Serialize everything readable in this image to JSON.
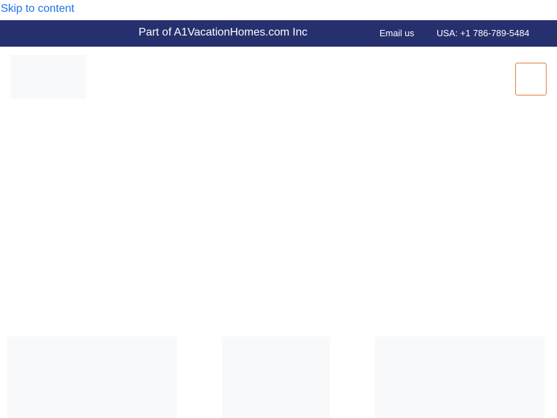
{
  "skip_link": {
    "label": "Skip to content"
  },
  "topbar": {
    "title": "Part of A1VacationHomes.com Inc",
    "email_label": "Email us",
    "phone_label": "USA: +1 786-789-5484",
    "background": "#26306e"
  },
  "header": {
    "menu_toggle_border": "#e07b39"
  }
}
